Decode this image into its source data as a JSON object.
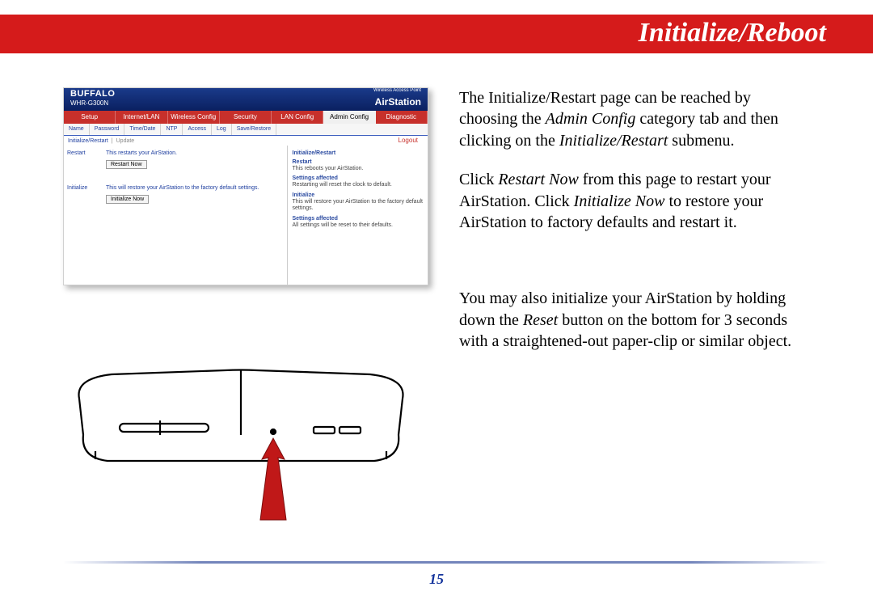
{
  "title": "Initialize/Reboot",
  "page_number": "15",
  "screenshot": {
    "logo": "BUFFALO",
    "model": "WHR-G300N",
    "brand_sub": "Wireless Access Point",
    "brand": "AirStation",
    "tabs": [
      "Setup",
      "Internet/LAN",
      "Wireless Config",
      "Security",
      "LAN Config",
      "Admin Config",
      "Diagnostic"
    ],
    "subtabs": [
      "Name",
      "Password",
      "Time/Date",
      "NTP",
      "Access",
      "Log",
      "Save/Restore"
    ],
    "active_sub": "Initialize/Restart",
    "active_sub2": "Update",
    "logout": "Logout",
    "row_restart_label": "Restart",
    "row_restart_note": "This restarts your AirStation.",
    "row_restart_btn": "Restart Now",
    "row_init_label": "Initialize",
    "row_init_note": "This will restore your AirStation to the factory default settings.",
    "row_init_btn": "Initialize Now",
    "side_h1": "Initialize/Restart",
    "side_h2": "Restart",
    "side_t1": "This reboots your AirStation.",
    "side_sa": "Settings affected",
    "side_t2": "Restarting will reset the clock to default.",
    "side_h3": "Initialize",
    "side_t3": "This will restore your AirStation to the factory default settings.",
    "side_t4": "All settings will be reset to their defaults."
  },
  "para1_a": "The Initialize/Restart page can be reached by choosing the ",
  "para1_em1": "Admin Config",
  "para1_b": " category tab and then clicking on the ",
  "para1_em2": "Initialize/Restart",
  "para1_c": " submenu.",
  "para2_a": "Click ",
  "para2_em1": "Restart Now",
  "para2_b": " from this page to restart your AirStation.  Click ",
  "para2_em2": "Initialize Now",
  "para2_c": " to restore your AirStation to factory defaults and restart it.",
  "para3_a": "You may also initialize your AirStation by holding down the ",
  "para3_em1": "Reset",
  "para3_b": " button on the bottom for 3 seconds with a straightened-out paper-clip or similar object."
}
